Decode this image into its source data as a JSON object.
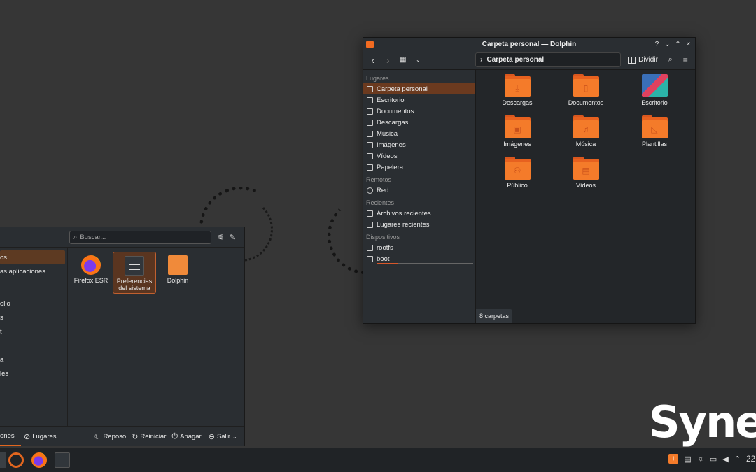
{
  "brand": "Synex",
  "dolphin": {
    "title": "Carpeta personal — Dolphin",
    "controls": [
      "?",
      "⌄",
      "⌃",
      "×"
    ],
    "breadcrumb": "Carpeta personal",
    "split_label": "Dividir",
    "sections": {
      "places": "Lugares",
      "remote": "Remotos",
      "recent": "Recientes",
      "devices": "Dispositivos"
    },
    "places": [
      "Carpeta personal",
      "Escritorio",
      "Documentos",
      "Descargas",
      "Música",
      "Imágenes",
      "Vídeos",
      "Papelera"
    ],
    "remote": [
      "Red"
    ],
    "recent": [
      "Archivos recientes",
      "Lugares recientes"
    ],
    "devices": [
      {
        "label": "rootfs",
        "usage": 0.18
      },
      {
        "label": "boot",
        "usage": 0.22
      }
    ],
    "files": [
      "Descargas",
      "Documentos",
      "Escritorio",
      "Imágenes",
      "Música",
      "Plantillas",
      "Público",
      "Vídeos"
    ],
    "status": "8 carpetas"
  },
  "launcher": {
    "search_placeholder": "Buscar...",
    "categories": [
      "os",
      "as aplicaciones",
      "",
      "",
      "ollo",
      "s",
      "t",
      "",
      "a",
      "les"
    ],
    "apps": [
      {
        "label1": "Firefox ESR",
        "label2": ""
      },
      {
        "label1": "Preferencias",
        "label2": "del sistema"
      },
      {
        "label1": "Dolphin",
        "label2": ""
      }
    ],
    "footer": {
      "apps_tab": "ones",
      "places_tab": "Lugares",
      "sleep": "Reposo",
      "restart": "Reiniciar",
      "shutdown": "Apagar",
      "leave": "Salir"
    }
  },
  "taskbar": {
    "clock": "22"
  }
}
